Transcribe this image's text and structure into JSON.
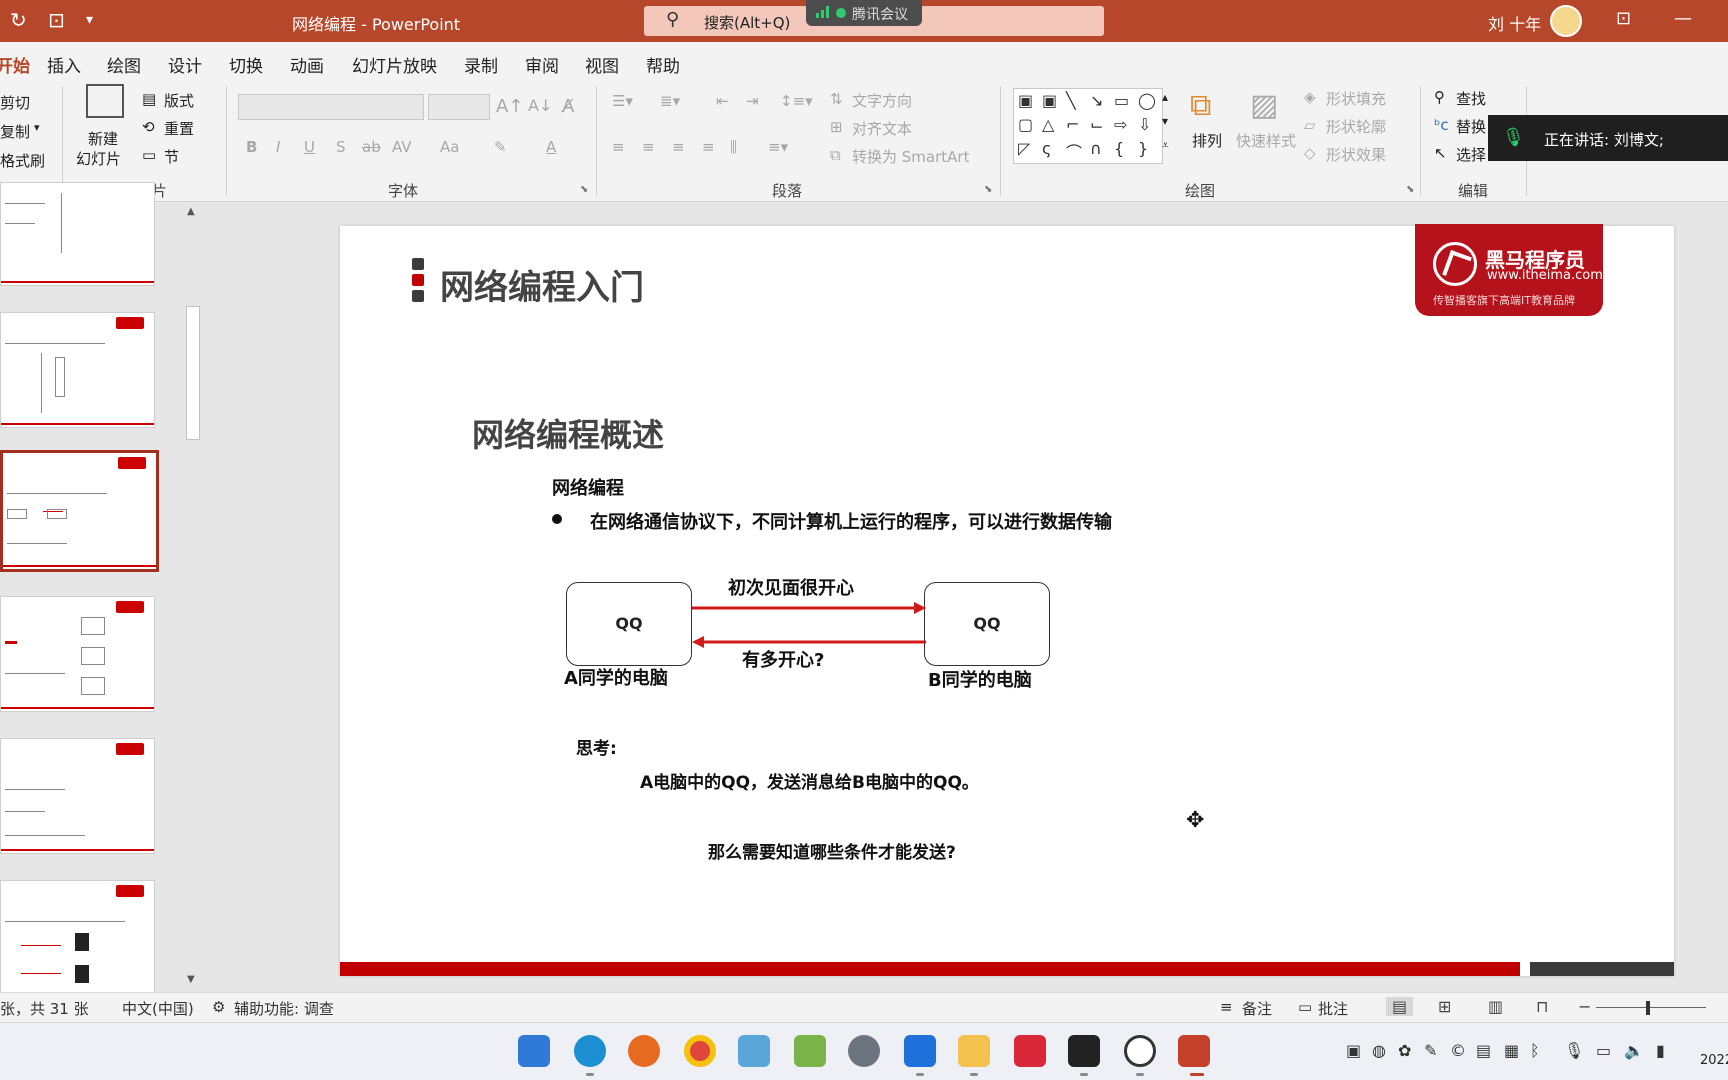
{
  "window": {
    "title": "网络编程 - PowerPoint",
    "search_placeholder": "搜索(Alt+Q)",
    "meeting_badge": "腾讯会议",
    "user": "刘 十年"
  },
  "tabs": [
    "开始",
    "插入",
    "绘图",
    "设计",
    "切换",
    "动画",
    "幻灯片放映",
    "录制",
    "审阅",
    "视图",
    "帮助"
  ],
  "ribbon": {
    "clipboard": {
      "cut": "剪切",
      "copy": "复制",
      "format_painter": "格式刷"
    },
    "slides": {
      "new_slide_1": "新建",
      "new_slide_2": "幻灯片",
      "layout": "版式",
      "reset": "重置",
      "section": "节",
      "label": "幻灯片"
    },
    "font": {
      "label": "字体",
      "bold": "B",
      "italic": "I",
      "underline": "U",
      "shadow": "S",
      "strike": "ab",
      "spacing": "AV",
      "case": "Aa"
    },
    "paragraph": {
      "label": "段落",
      "text_direction": "文字方向",
      "align_text": "对齐文本",
      "smartart": "转换为 SmartArt"
    },
    "drawing": {
      "label": "绘图",
      "arrange": "排列",
      "quick_styles": "快速样式",
      "fill": "形状填充",
      "outline": "形状轮廓",
      "effects": "形状效果"
    },
    "editing": {
      "label": "编辑",
      "find": "查找",
      "replace": "替换",
      "select": "选择"
    }
  },
  "speaking": "正在讲话: 刘博文;",
  "slide": {
    "title": "网络编程入门",
    "logo_name": "黑马程序员",
    "logo_url": "www.itheima.com",
    "logo_sub": "传智播客旗下高端IT教育品牌",
    "subtitle": "网络编程概述",
    "heading": "网络编程",
    "bullet": "在网络通信协议下，不同计算机上运行的程序，可以进行数据传输",
    "box_a": "QQ",
    "box_b": "QQ",
    "caption_a": "A同学的电脑",
    "caption_b": "B同学的电脑",
    "arrow_top": "初次见面很开心",
    "arrow_bottom": "有多开心?",
    "think_label": "思考:",
    "think_line1": "A电脑中的QQ，发送消息给B电脑中的QQ。",
    "think_line2": "那么需要知道哪些条件才能发送?"
  },
  "status": {
    "slide_count": "张，共 31 张",
    "language": "中文(中国)",
    "accessibility": "辅助功能: 调查",
    "notes": "备注",
    "comments": "批注"
  },
  "clock": "2022",
  "colors": {
    "accent": "#b7472a",
    "brand_red": "#c00000",
    "arrow_red": "#d11a1a"
  }
}
